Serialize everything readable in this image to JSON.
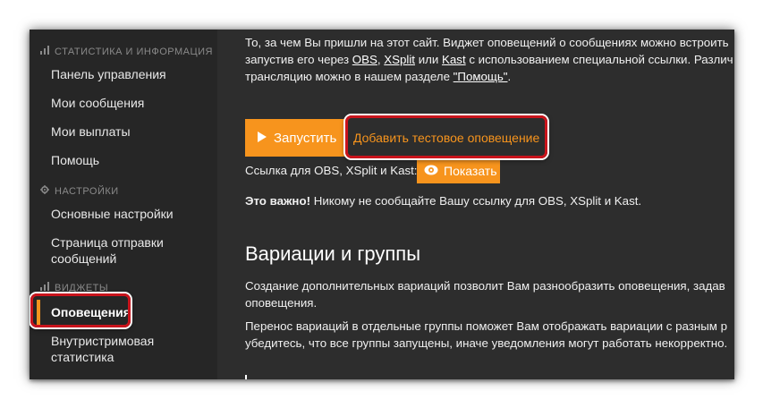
{
  "sidebar": {
    "sections": [
      {
        "title": "СТАТИСТИКА И ИНФОРМАЦИЯ",
        "icon": "bar-chart-icon"
      },
      {
        "title": "НАСТРОЙКИ",
        "icon": "gear-icon"
      },
      {
        "title": "ВИДЖЕТЫ",
        "icon": "bar-chart-icon"
      }
    ],
    "items": [
      {
        "label": "Панель управления"
      },
      {
        "label": "Мои сообщения"
      },
      {
        "label": "Мои выплаты"
      },
      {
        "label": "Помощь"
      },
      {
        "label": "Основные настройки"
      },
      {
        "label": "Страница отправки"
      },
      {
        "label": "сообщений"
      },
      {
        "label": "Оповещения"
      },
      {
        "label": "Внутристримовая"
      },
      {
        "label": "статистика"
      }
    ]
  },
  "main": {
    "intro_line1": "То, за чем Вы пришли на этот сайт. Виджет оповещений о сообщениях можно встроить",
    "intro_line2_pre": "запустив его через ",
    "obs": "OBS",
    "comma": ", ",
    "xsplit": "XSplit",
    "or": " или ",
    "kast": "Kast",
    "intro_line2_post": " с использованием специальной ссылки. Различ",
    "intro_line3_pre": "трансляцию можно в нашем разделе ",
    "help_link": "\"Помощь\"",
    "intro_line3_post": ".",
    "run_button": "Запустить",
    "add_test_button": "Добавить тестовое оповещение",
    "link_label": "Ссылка для OBS, XSplit и Kast:",
    "show_button": "Показать",
    "important_bold": "Это важно!",
    "important_text": " Никому не сообщайте Вашу ссылку для OBS, XSplit и Kast.",
    "section_title": "Вариации и группы",
    "para1_line1": "Создание дополнительных вариаций позволит Вам разнообразить оповещения, задав",
    "para1_line2": "оповещения.",
    "para2_line1": "Перенос вариаций в отдельные группы поможет Вам отображать вариации с разным р",
    "para2_line2": "убедитесь, что все группы запущены, иначе уведомления могут работать некорректно."
  },
  "colors": {
    "accent": "#f7941d",
    "highlight": "#c9141c",
    "panel": "#2d2d2d"
  }
}
